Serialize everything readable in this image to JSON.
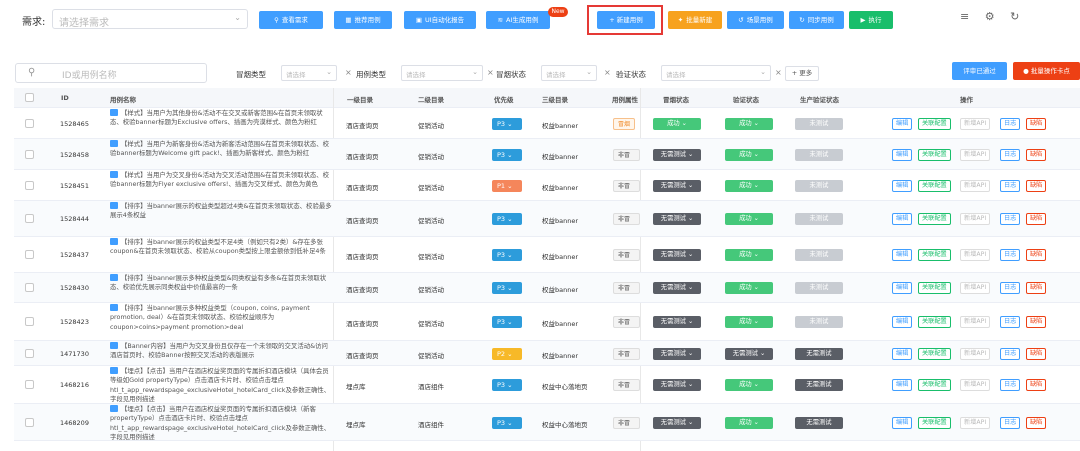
{
  "toolbar": {
    "requirement_label": "需求:",
    "requirement_placeholder": "请选择需求",
    "buttons": [
      {
        "label": "查看需求",
        "icon": "search-icon"
      },
      {
        "label": "推荐用例",
        "icon": "list-icon"
      },
      {
        "label": "UI自动化报告",
        "icon": "report-icon"
      },
      {
        "label": "AI生成用例",
        "icon": "ai-icon"
      },
      {
        "label": "+ 新建用例",
        "icon": "plus-icon"
      },
      {
        "label": "批量新建",
        "icon": "batch-icon"
      },
      {
        "label": "场景用例",
        "icon": "link-icon"
      },
      {
        "label": "同步用例",
        "icon": "sync-icon"
      },
      {
        "label": "执行",
        "icon": "play-icon"
      }
    ],
    "new_badge": "New",
    "icons": [
      "menu-icon",
      "gear-icon",
      "refresh-icon"
    ]
  },
  "filters": {
    "search_placeholder": "ID或用例名称",
    "items": [
      {
        "label": "冒烟类型",
        "placeholder": "请选择"
      },
      {
        "label": "用例类型",
        "placeholder": "请选择"
      },
      {
        "label": "冒烟状态",
        "placeholder": "请选择"
      },
      {
        "label": "验证状态",
        "placeholder": "请选择"
      }
    ],
    "more_label": "+ 更多",
    "review_passed_label": "评审已通过",
    "batch_label": "● 批量操作卡点"
  },
  "table": {
    "columns": [
      "ID",
      "用例名称",
      "一级目录",
      "二级目录",
      "优先级",
      "三级目录",
      "用例属性",
      "冒烟状态",
      "验证状态",
      "生产验证状态",
      "操作"
    ],
    "actions": [
      "编辑",
      "关联配置",
      "新增API",
      "日志",
      "缺陷"
    ],
    "rows": [
      {
        "id": "1528465",
        "name": "【样式】当用户为其他身份&活动不在交叉或新客范围&在首页未领取状态、校验banner标题为Exclusive offers、插画为壳漠样式、颜色为粉红",
        "l1": "酒店查询页",
        "l2": "促销活动",
        "priority": "P3",
        "l3": "权益banner",
        "attr": "冒烟",
        "smoke": "成功",
        "verify": "成功",
        "prod": "未测试"
      },
      {
        "id": "1528458",
        "name": "【样式】当用户为新客身份&活动为新客活动范围&在首页未领取状态、校验banner标题为Welcome gift pack!、插画为新客样式、颜色为粉红",
        "l1": "酒店查询页",
        "l2": "促销活动",
        "priority": "P3",
        "l3": "权益banner",
        "attr": "非冒烟",
        "smoke": "无需测试",
        "verify": "成功",
        "prod": "未测试"
      },
      {
        "id": "1528451",
        "name": "【样式】当用户为交叉身份&活动为交叉活动范围&在首页未领取状态、校验banner标题为Flyer exclusive offers!、插画为交叉样式、颜色为黄色",
        "l1": "酒店查询页",
        "l2": "促销活动",
        "priority": "P1",
        "l3": "权益banner",
        "attr": "非冒烟",
        "smoke": "无需测试",
        "verify": "成功",
        "prod": "未测试"
      },
      {
        "id": "1528444",
        "name": "【排序】当banner展示的权益类型超过4类&在首页未领取状态、校验最多展示4条权益",
        "l1": "酒店查询页",
        "l2": "促销活动",
        "priority": "P3",
        "l3": "权益banner",
        "attr": "非冒烟",
        "smoke": "无需测试",
        "verify": "成功",
        "prod": "未测试"
      },
      {
        "id": "1528437",
        "name": "【排序】当banner展示的权益类型不足4类（例如只有2类）&存在多张coupon&在首页未领取状态、校验从coupon类型按上限金额依到低补足4条",
        "l1": "酒店查询页",
        "l2": "促销活动",
        "priority": "P3",
        "l3": "权益banner",
        "attr": "非冒烟",
        "smoke": "无需测试",
        "verify": "成功",
        "prod": "未测试"
      },
      {
        "id": "1528430",
        "name": "【排序】当banner展示多种权益类型&同类权益有多条&在首页未领取状态、校验优先展示同类权益中价值最高的一条",
        "l1": "酒店查询页",
        "l2": "促销活动",
        "priority": "P3",
        "l3": "权益banner",
        "attr": "非冒烟",
        "smoke": "无需测试",
        "verify": "成功",
        "prod": "未测试"
      },
      {
        "id": "1528423",
        "name": "【排序】当banner展示多种权益类型（coupon, coins, payment promotion, deal）&在首页未领取状态、校验权益顺序为coupon>coins>payment promotion>deal",
        "l1": "酒店查询页",
        "l2": "促销活动",
        "priority": "P3",
        "l3": "权益banner",
        "attr": "非冒烟",
        "smoke": "无需测试",
        "verify": "成功",
        "prod": "未测试"
      },
      {
        "id": "1471730",
        "name": "【Banner内容】当用户为交叉身份且仅存在一个未领取的交叉活动&访问酒店首页时、校验Banner按照交叉活动的表版展示",
        "l1": "酒店查询页",
        "l2": "促销活动",
        "priority": "P2",
        "l3": "权益banner",
        "attr": "非冒烟",
        "smoke": "无需测试",
        "verify": "无需测试",
        "prod": "无需测试"
      },
      {
        "id": "1468216",
        "name": "【埋点】【点击】当用户在酒店权益奖页面的专属折扣酒店模块（具体会员等级如Gold propertyType）点击酒店卡片时、校验点击埋点htl_t_app_rewardspage_exclusiveHotel_hotelCard_click及参数正确性、字段见用例描述",
        "l1": "埋点库",
        "l2": "酒店组件",
        "priority": "P3",
        "l3": "权益中心落地页",
        "attr": "非冒烟",
        "smoke": "无需测试",
        "verify": "成功",
        "prod": "无需测试"
      },
      {
        "id": "1468209",
        "name": "【埋点】【点击】当用户在酒店权益奖页面的专属折扣酒店模块（新客propertyType）点击酒店卡片时、校验点击埋点htl_t_app_rewardspage_exclusiveHotel_hotelCard_click及参数正确性、字段见用例描述",
        "l1": "埋点库",
        "l2": "酒店组件",
        "priority": "P3",
        "l3": "权益中心落地页",
        "attr": "非冒烟",
        "smoke": "无需测试",
        "verify": "成功",
        "prod": "无需测试"
      }
    ]
  }
}
